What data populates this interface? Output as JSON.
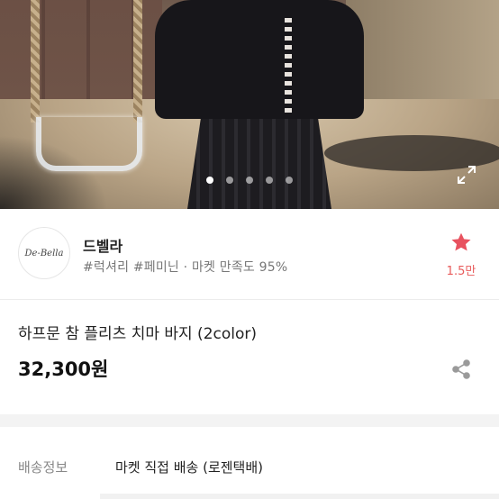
{
  "carousel": {
    "dot_count": 5,
    "active_index": 0
  },
  "shop": {
    "logo_text": "De-Bella",
    "name": "드벨라",
    "tags": "#럭셔리 #페미닌 · 마켓 만족도 95%",
    "favorite_count": "1.5만"
  },
  "product": {
    "title": "하프문 참 플리츠 치마 바지 (2color)",
    "price": "32,300원"
  },
  "shipping": {
    "label": "배송정보",
    "value": "마켓 직접 배송 (로젠택배)"
  },
  "colors": {
    "star": "#e8525f",
    "favorite_text": "#e85b5b"
  },
  "icons": {
    "expand": "expand-icon",
    "star": "star-icon",
    "share": "share-icon"
  }
}
